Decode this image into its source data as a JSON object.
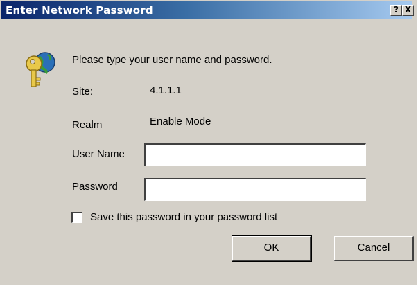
{
  "window": {
    "title": "Enter Network Password",
    "help_glyph": "?",
    "close_glyph": "X"
  },
  "icons": {
    "dialog_icon": "key-icon",
    "help": "help-icon",
    "close": "close-icon"
  },
  "form": {
    "prompt": "Please type your user name and password.",
    "site_label": "Site:",
    "site_value": "4.1.1.1",
    "realm_label": "Realm",
    "realm_value": "Enable Mode",
    "user_label": "User Name",
    "user_value": "",
    "password_label": "Password",
    "password_value": "",
    "save_label": "Save this password in your password list",
    "save_checked": false
  },
  "buttons": {
    "ok": "OK",
    "cancel": "Cancel"
  },
  "colors": {
    "title_start": "#0a246a",
    "title_end": "#a6caf0",
    "dialog_bg": "#d4d0c8"
  }
}
